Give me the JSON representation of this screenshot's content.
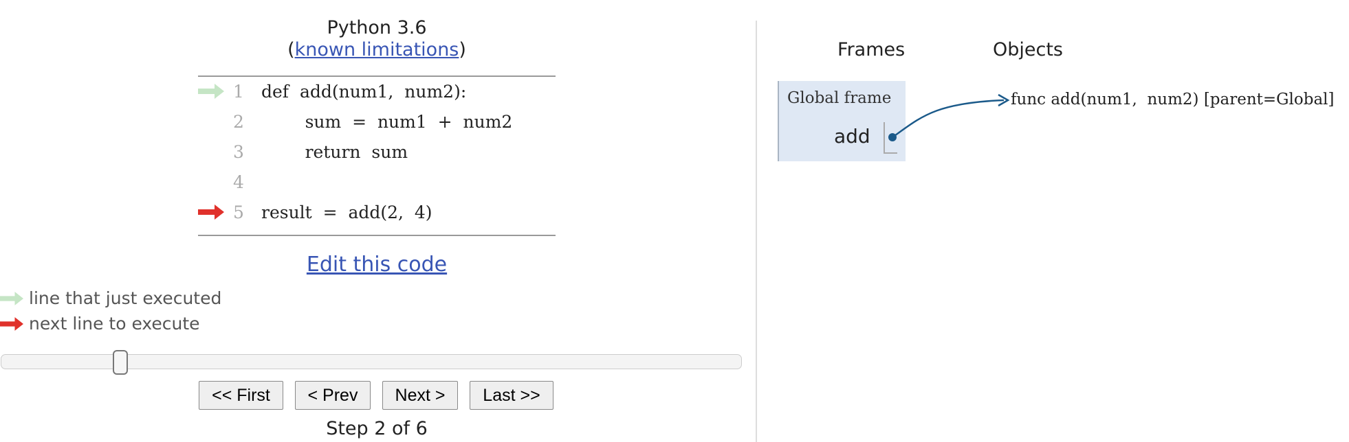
{
  "header": {
    "language": "Python 3.6",
    "limitations_open": "(",
    "limitations_link": "known limitations",
    "limitations_close": ")"
  },
  "code": {
    "lines": [
      {
        "num": "1",
        "text": "def  add(num1,  num2):"
      },
      {
        "num": "2",
        "text": "        sum  =  num1  +  num2"
      },
      {
        "num": "3",
        "text": "        return  sum"
      },
      {
        "num": "4",
        "text": ""
      },
      {
        "num": "5",
        "text": "result  =  add(2,  4)"
      }
    ],
    "just_executed_line": 1,
    "next_line": 5
  },
  "edit_link": "Edit this code",
  "legend": {
    "just_executed": "line that just executed",
    "next_to_execute": "next line to execute"
  },
  "slider": {
    "step": 2,
    "total": 6
  },
  "nav": {
    "first": "<< First",
    "prev": "< Prev",
    "next": "Next >",
    "last": "Last >>"
  },
  "step_text": "Step 2 of 6",
  "viz": {
    "frames_label": "Frames",
    "objects_label": "Objects",
    "global_frame_title": "Global frame",
    "variable_name": "add",
    "function_object": "func add(num1,  num2) [parent=Global]"
  },
  "colors": {
    "just_executed_arrow": "#c5e5c5",
    "next_arrow": "#e0312b",
    "link": "#3855b4",
    "frame_bg": "#dfe8f4",
    "pointer": "#1b5a8a"
  }
}
